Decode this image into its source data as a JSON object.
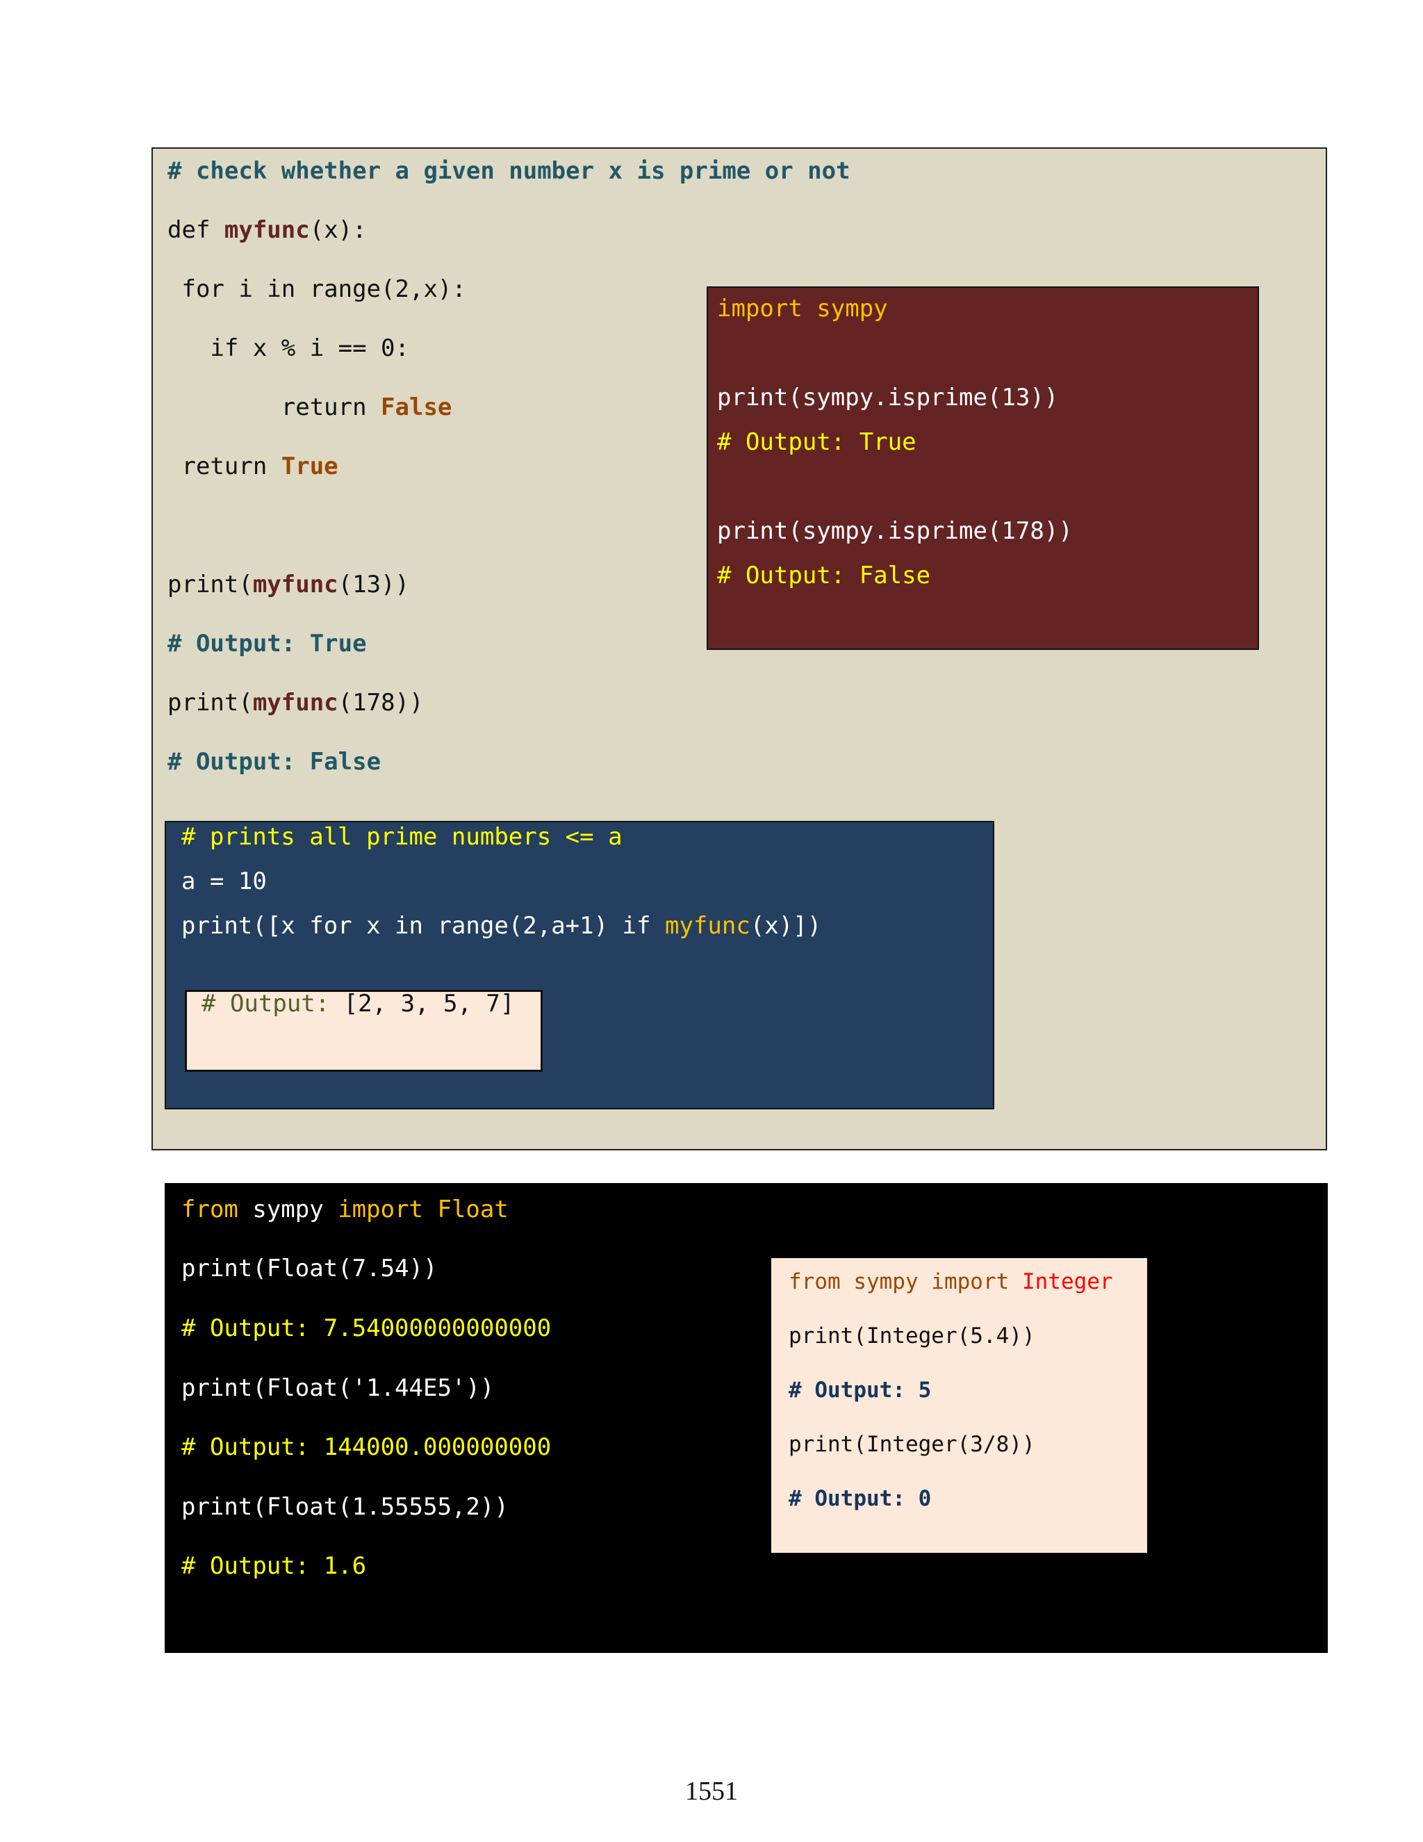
{
  "main_panel": {
    "lines": [
      {
        "text": "# check whether a given number x is prime or not"
      },
      {
        "parts": [
          "def ",
          "myfunc",
          "(x):"
        ]
      },
      {
        "text": " for i in range(2,x):"
      },
      {
        "text": "   if x % i == 0:"
      },
      {
        "parts": [
          "        return ",
          "False"
        ]
      },
      {
        "parts": [
          " return ",
          "True"
        ]
      },
      {
        "parts": [
          "print(",
          "myfunc",
          "(13))"
        ]
      },
      {
        "text": "# Output: True"
      },
      {
        "parts": [
          "print(",
          "myfunc",
          "(178))"
        ]
      },
      {
        "text": "# Output: False"
      }
    ]
  },
  "isprime_panel": {
    "lines": [
      {
        "text": "import sympy"
      },
      {
        "text": "print(sympy.isprime(13))"
      },
      {
        "text": "# Output: True"
      },
      {
        "text": "print(sympy.isprime(178))"
      },
      {
        "text": "# Output: False"
      }
    ]
  },
  "primes_panel": {
    "lines": [
      {
        "text": "# prints all prime numbers <= a"
      },
      {
        "text": "a = 10"
      },
      {
        "parts": [
          "print([x for x in range(2,a+1) if ",
          "myfunc",
          "(x)])"
        ]
      }
    ],
    "output": {
      "parts": [
        "# Output: ",
        "[2, 3, 5, 7]"
      ]
    }
  },
  "float_panel": {
    "lines": [
      {
        "parts": [
          "from",
          " sympy ",
          "import Float"
        ]
      },
      {
        "text": "print(Float(7.54))"
      },
      {
        "text": "# Output: 7.54000000000000"
      },
      {
        "text": "print(Float('1.44E5'))"
      },
      {
        "text": "# Output: 144000.000000000"
      },
      {
        "text": "print(Float(1.55555,2))"
      },
      {
        "text": "# Output: 1.6"
      }
    ]
  },
  "integer_panel": {
    "lines": [
      {
        "parts": [
          "from sympy import ",
          "Integer"
        ]
      },
      {
        "text": "print(Integer(5.4))"
      },
      {
        "text": "# Output: 5"
      },
      {
        "text": "print(Integer(3/8))"
      },
      {
        "text": "# Output: 0"
      }
    ]
  },
  "page_number": "1551",
  "colors": {
    "beige_bg": "#ddd9c4",
    "maroon_bg": "#632423",
    "navy_bg": "#243f60",
    "peach_bg": "#fde9d9",
    "comment_teal": "#215868",
    "func_maroon": "#632423",
    "keyword_orange": "#984806",
    "yellow": "#ffff00",
    "gold": "#ffc000",
    "red": "#ff0000"
  }
}
